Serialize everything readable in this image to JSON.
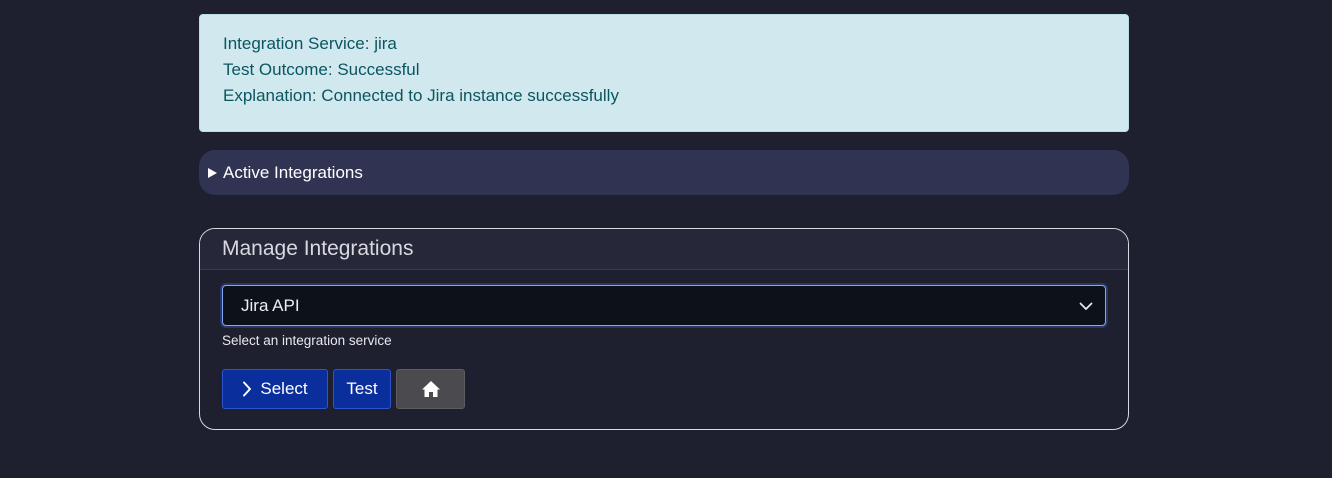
{
  "alert": {
    "service_line": "Integration Service: jira",
    "outcome_line": "Test Outcome: Successful",
    "explanation_line": "Explanation: Connected to Jira instance successfully"
  },
  "active_integrations": {
    "summary_label": "Active Integrations"
  },
  "manage": {
    "title": "Manage Integrations",
    "selected_service": "Jira API",
    "hint": "Select an integration service",
    "buttons": {
      "select_label": "Select",
      "test_label": "Test"
    }
  },
  "icons": {
    "summary_marker": "triangle-right-icon",
    "dropdown": "chevron-down-icon",
    "select": "chevron-right-icon",
    "home": "home-icon"
  },
  "colors": {
    "background": "#1e1f2f",
    "alert_bg": "#d1e9ee",
    "alert_text": "#0b5561",
    "primary_button": "#0a2f9c",
    "secondary_button": "#4b4b4f"
  }
}
